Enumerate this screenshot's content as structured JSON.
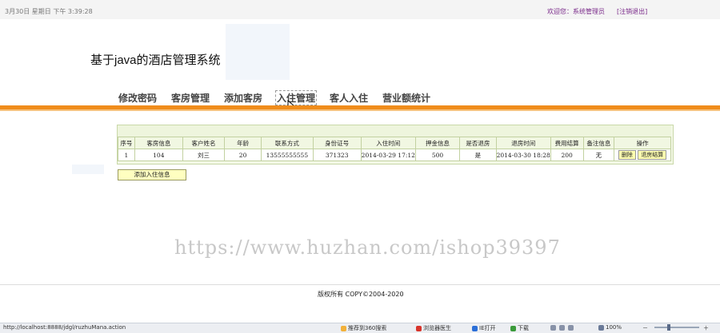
{
  "topbar": {
    "clock": "3月30日 星期日 下午 3:39:28",
    "welcome": "欢迎您：系统管理员",
    "logout": "[注销退出]"
  },
  "header": {
    "title": "基于java的酒店管理系统"
  },
  "nav": {
    "items": [
      {
        "label": "修改密码"
      },
      {
        "label": "客房管理"
      },
      {
        "label": "添加客房"
      },
      {
        "label": "入住管理"
      },
      {
        "label": "客人入住"
      },
      {
        "label": "营业额统计"
      }
    ],
    "active": "入住管理"
  },
  "table": {
    "headers": [
      "序号",
      "客房信息",
      "客户姓名",
      "年龄",
      "联系方式",
      "身份证号",
      "入住时间",
      "押金信息",
      "是否退房",
      "退房时间",
      "费用结算",
      "备注信息",
      "操作"
    ],
    "rows": [
      {
        "cells": [
          "1",
          "104",
          "刘三",
          "20",
          "13555555555",
          "371323",
          "2014-03-29 17:12",
          "500",
          "是",
          "2014-03-30 18:28",
          "200",
          "无"
        ],
        "delete_label": "删除",
        "checkout_label": "退房结算"
      }
    ],
    "add_label": "添加入住信息"
  },
  "watermark": "https://www.huzhan.com/ishop39397",
  "footer": {
    "copyright": "版权所有  COPY©2004-2020"
  },
  "statusbar": {
    "url": "http://localhost:8888/jdgl/ruzhuMana.action",
    "recommend": "推荐到360搜索",
    "doctor": "浏览器医生",
    "ie": "IE打开",
    "download": "下载",
    "zoom": "100%"
  },
  "colors": {
    "accent_orange": "#f08c1b",
    "table_border": "#c2d1a0",
    "button_yellow": "#fffeb0"
  }
}
